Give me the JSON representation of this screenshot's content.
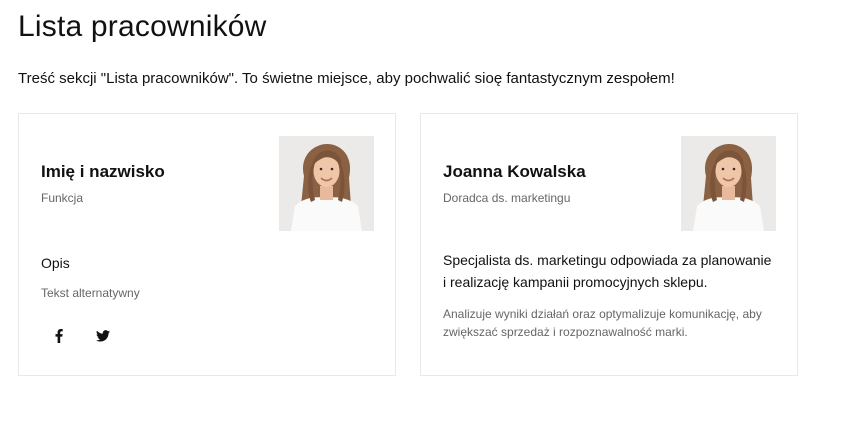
{
  "section": {
    "title": "Lista pracowników",
    "description": "Treść sekcji \"Lista pracowników\". To świetne miejsce, aby pochwalić sioę fantastycznym zespołem!"
  },
  "cards": [
    {
      "name": "Imię i nazwisko",
      "role": "Funkcja",
      "description": "Opis",
      "description_alt": "Tekst alternatywny",
      "social": [
        {
          "icon": "facebook-icon",
          "glyph": "f"
        },
        {
          "icon": "twitter-icon",
          "glyph": "twitter"
        }
      ]
    },
    {
      "name": "Joanna Kowalska",
      "role": "Doradca ds. marketingu",
      "description": "Specjalista ds. marketingu odpowiada za planowanie i realizację kampanii promocyjnych sklepu.",
      "description_alt": "Analizuje wyniki działań oraz optymalizuje komunikację, aby zwiększać sprzedaż i rozpoznawalność marki."
    }
  ],
  "colors": {
    "text": "#111111",
    "muted": "#666666",
    "border": "#e8e8e8"
  }
}
